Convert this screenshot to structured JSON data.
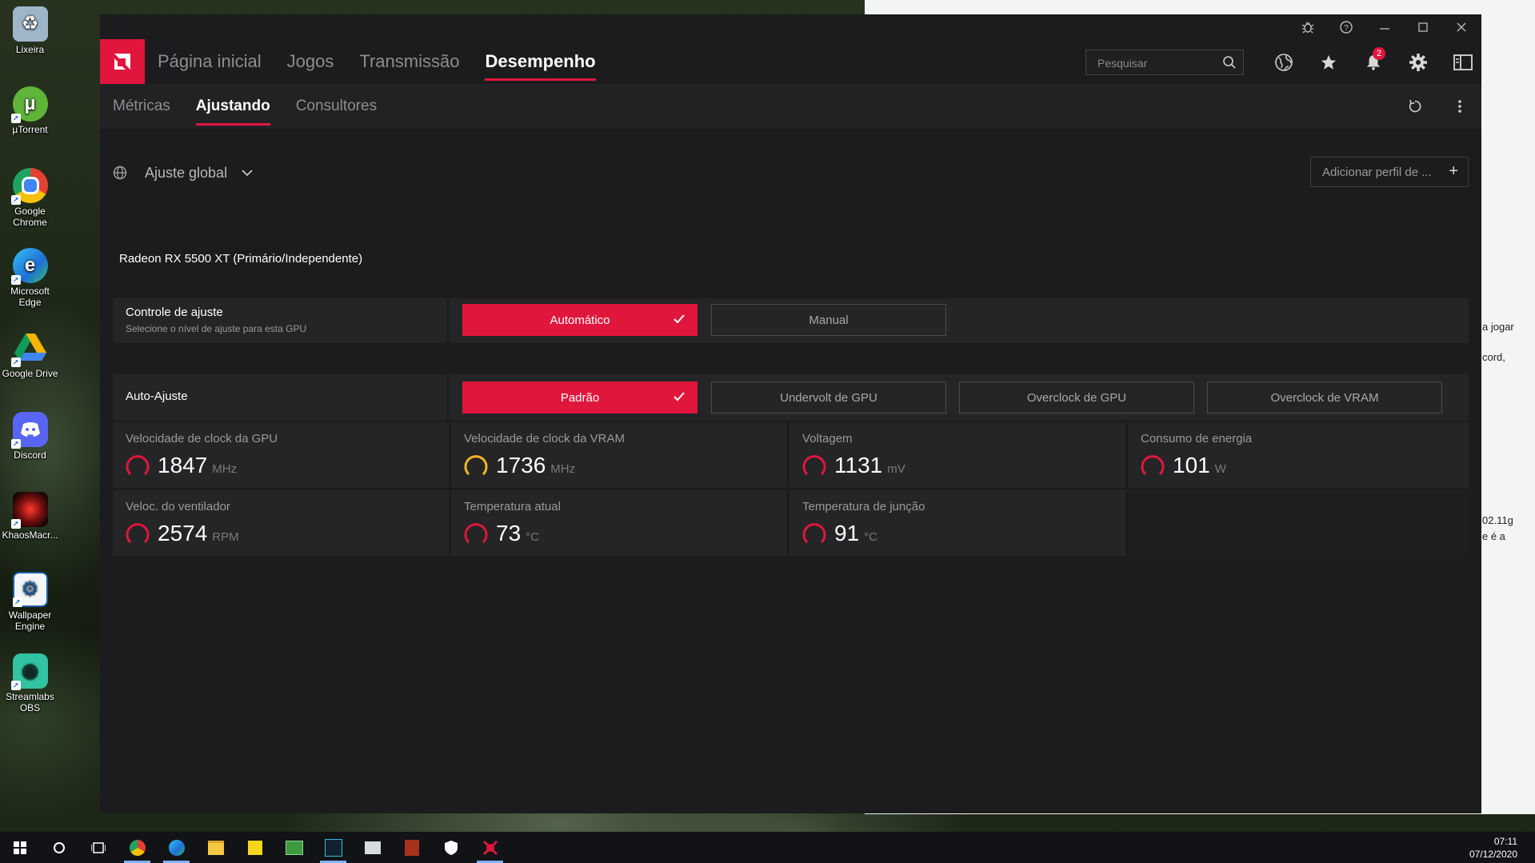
{
  "desktop": {
    "icons": [
      {
        "label": "Lixeira",
        "icon": "recycle-bin-icon",
        "color": "#9fb6c9"
      },
      {
        "label": "µTorrent",
        "icon": "utorrent-icon",
        "color": "#5fb43a"
      },
      {
        "label": "Google Chrome",
        "icon": "chrome-icon",
        "color": "#e34133"
      },
      {
        "label": "Microsoft Edge",
        "icon": "edge-icon",
        "color": "#1e88d6"
      },
      {
        "label": "Google Drive",
        "icon": "google-drive-icon",
        "color": "#f4b400"
      },
      {
        "label": "Discord",
        "icon": "discord-icon",
        "color": "#5865f2"
      },
      {
        "label": "KhaosMacr...",
        "icon": "khaos-icon",
        "color": "#7a1010"
      },
      {
        "label": "Wallpaper Engine",
        "icon": "wallpaper-engine-icon",
        "color": "#1d5fa6"
      },
      {
        "label": "Streamlabs OBS",
        "icon": "streamlabs-icon",
        "color": "#31c3a2"
      }
    ],
    "background_window_text": [
      "a jogar",
      "cord,",
      "02.11g",
      "e é a"
    ]
  },
  "taskbar": {
    "time": "07:11",
    "date": "07/12/2020",
    "items": [
      "start-icon",
      "search-circle-icon",
      "task-view-icon",
      "chrome-icon",
      "edge-icon",
      "file-explorer-icon",
      "sticky-notes-icon",
      "photos-icon",
      "game-icon",
      "mail-icon",
      "cod-icon",
      "shield-icon",
      "amd-icon"
    ]
  },
  "amd": {
    "accent": "#e0163d",
    "topnav": {
      "items": [
        "Página inicial",
        "Jogos",
        "Transmissão",
        "Desempenho"
      ],
      "active_index": 3,
      "search_placeholder": "Pesquisar",
      "notification_count": "2"
    },
    "subnav": {
      "items": [
        "Métricas",
        "Ajustando",
        "Consultores"
      ],
      "active_index": 1
    },
    "profile": {
      "name": "Ajuste global",
      "add_label": "Adicionar perfil de ..."
    },
    "gpu_name": "Radeon RX 5500 XT (Primário/Independente)",
    "tuning_control": {
      "title": "Controle de ajuste",
      "subtitle": "Selecione o nível de ajuste para esta GPU",
      "options": [
        "Automático",
        "Manual"
      ],
      "selected": "Automático"
    },
    "auto_tuning": {
      "title": "Auto-Ajuste",
      "options": [
        "Padrão",
        "Undervolt de GPU",
        "Overclock de GPU",
        "Overclock de VRAM"
      ],
      "selected": "Padrão"
    },
    "metrics": [
      {
        "label": "Velocidade de clock da GPU",
        "value": "1847",
        "unit": "MHz",
        "gauge_color": "#e0163d"
      },
      {
        "label": "Velocidade de clock da VRAM",
        "value": "1736",
        "unit": "MHz",
        "gauge_color": "#f2b61f"
      },
      {
        "label": "Voltagem",
        "value": "1131",
        "unit": "mV",
        "gauge_color": "#e0163d"
      },
      {
        "label": "Consumo de energia",
        "value": "101",
        "unit": "W",
        "gauge_color": "#e0163d"
      },
      {
        "label": "Veloc. do ventilador",
        "value": "2574",
        "unit": "RPM",
        "gauge_color": "#e0163d"
      },
      {
        "label": "Temperatura atual",
        "value": "73",
        "unit": "°C",
        "gauge_color": "#e0163d"
      },
      {
        "label": "Temperatura de junção",
        "value": "91",
        "unit": "°C",
        "gauge_color": "#e0163d"
      }
    ]
  }
}
